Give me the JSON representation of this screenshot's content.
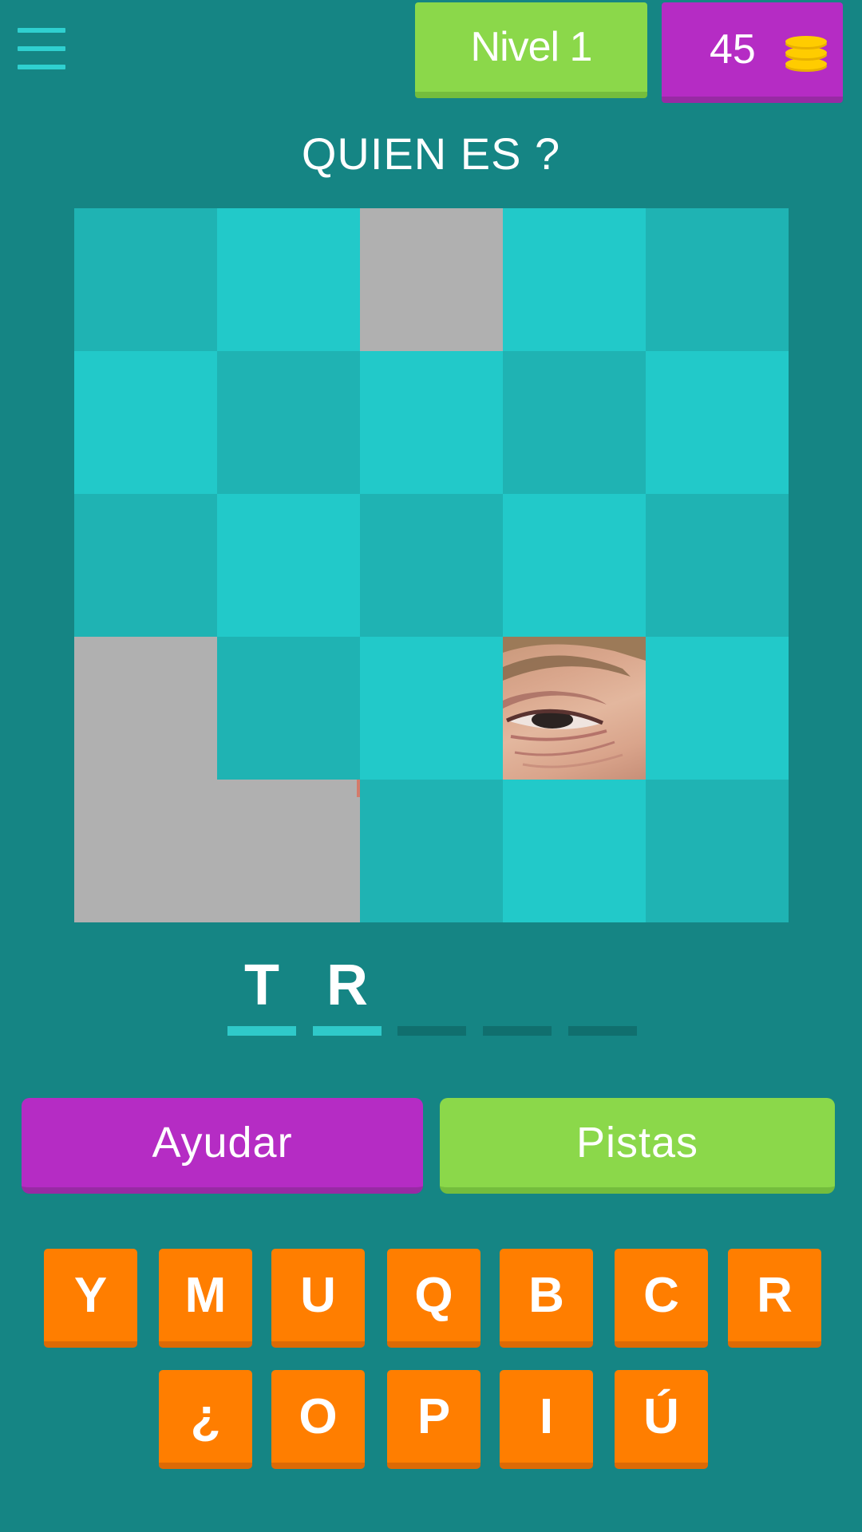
{
  "header": {
    "menu_icon": "hamburger-menu-icon",
    "level_label": "Nivel 1",
    "coins": "45",
    "coin_icon": "coin-stack-icon",
    "colors": {
      "background": "#158584",
      "level_badge": "#8bd84a",
      "coins_badge": "#b52cc4"
    }
  },
  "question": "QUIEN ES ?",
  "puzzle": {
    "rows": 5,
    "cols": 5,
    "revealed_tiles": [
      "r1c3 gray",
      "r4c1 gray",
      "r4c4 eye",
      "r5c1 gray",
      "r5c2 gray"
    ],
    "tile_colors": [
      "#1fb3b3",
      "#22c9c9",
      "#b0b0b0"
    ]
  },
  "answer": {
    "slots": [
      "T",
      "R",
      "",
      "",
      ""
    ]
  },
  "actions": {
    "help_label": "Ayudar",
    "hints_label": "Pistas"
  },
  "keyboard": {
    "row1": [
      "Y",
      "M",
      "U",
      "Q",
      "B",
      "C",
      "R"
    ],
    "row2": [
      "¿",
      "O",
      "P",
      "I",
      "Ú"
    ],
    "key_color": "#ff7e00"
  }
}
